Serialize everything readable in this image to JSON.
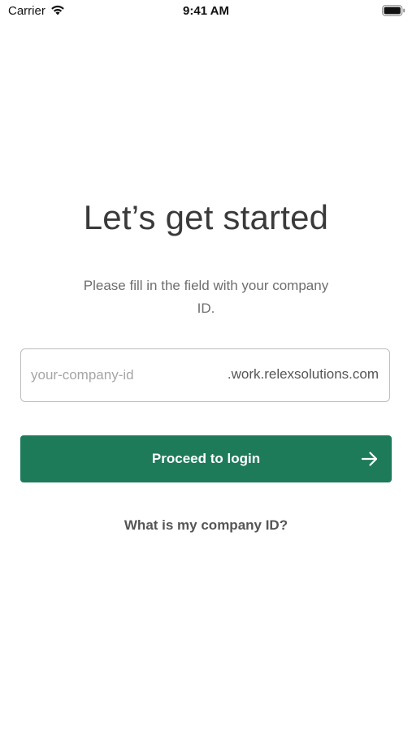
{
  "status_bar": {
    "carrier": "Carrier",
    "time": "9:41 AM",
    "icons": [
      "wifi-icon",
      "battery-icon"
    ]
  },
  "main": {
    "title": "Let’s get started",
    "subtitle": "Please fill in the field with your company ID.",
    "company_field": {
      "placeholder": "your-company-id",
      "value": "",
      "suffix": ".work.relexsolutions.com"
    },
    "proceed_button": {
      "label": "Proceed to login",
      "icon": "arrow-right-icon",
      "color": "#1e7b5a"
    },
    "help_link": "What is my company ID?"
  }
}
